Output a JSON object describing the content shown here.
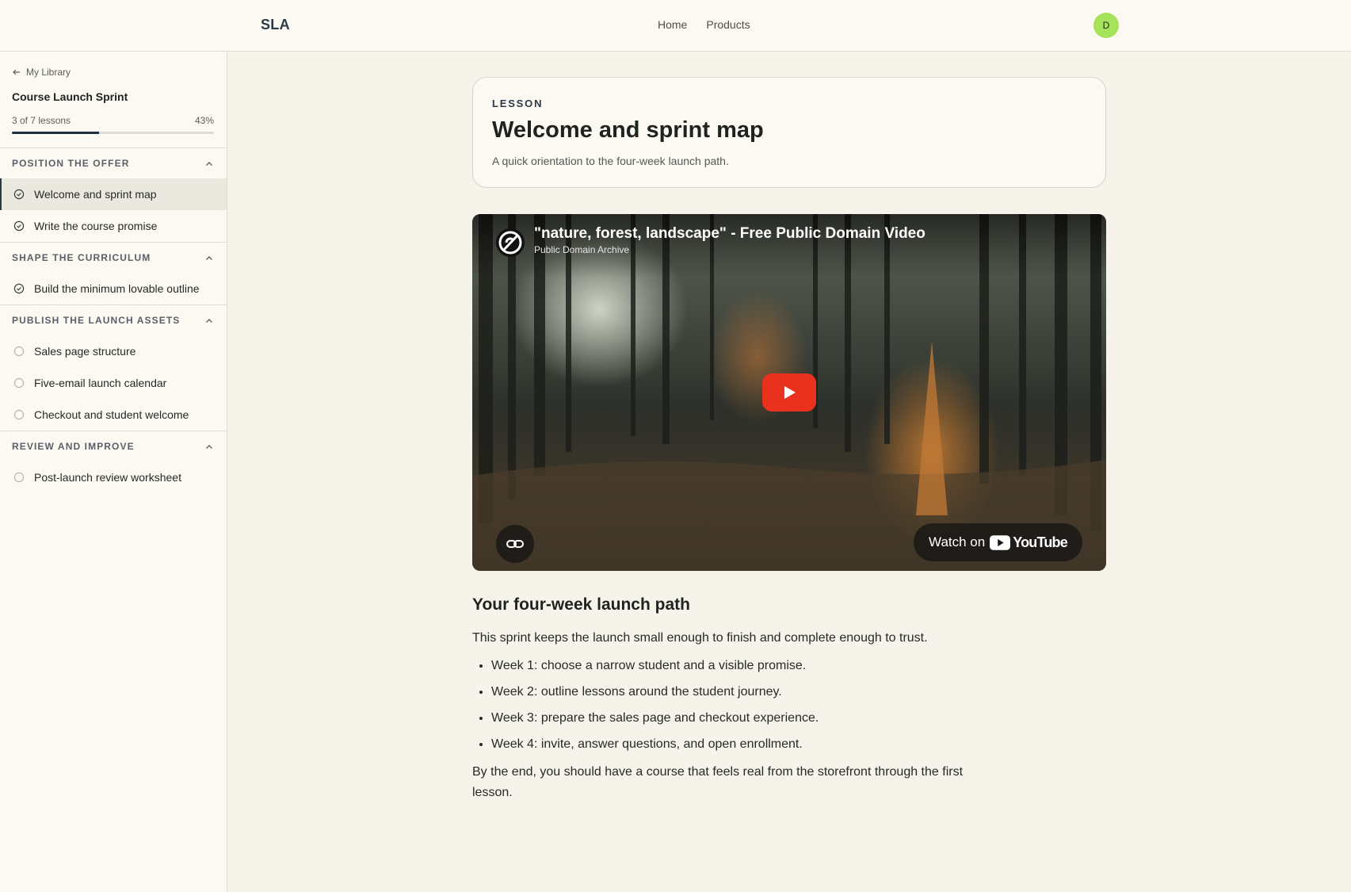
{
  "header": {
    "brand": "SLA",
    "nav": [
      "Home",
      "Products"
    ],
    "avatar_initial": "D"
  },
  "sidebar": {
    "back_label": "My Library",
    "course_title": "Course Launch Sprint",
    "progress_text": "3 of 7 lessons",
    "progress_percent_label": "43%",
    "progress_fraction": 0.43,
    "modules": [
      {
        "title": "POSITION THE OFFER",
        "lessons": [
          {
            "label": "Welcome and sprint map",
            "completed": true,
            "active": true
          },
          {
            "label": "Write the course promise",
            "completed": true,
            "active": false
          }
        ]
      },
      {
        "title": "SHAPE THE CURRICULUM",
        "lessons": [
          {
            "label": "Build the minimum lovable outline",
            "completed": true,
            "active": false
          }
        ]
      },
      {
        "title": "PUBLISH THE LAUNCH ASSETS",
        "lessons": [
          {
            "label": "Sales page structure",
            "completed": false,
            "active": false
          },
          {
            "label": "Five-email launch calendar",
            "completed": false,
            "active": false
          },
          {
            "label": "Checkout and student welcome",
            "completed": false,
            "active": false
          }
        ]
      },
      {
        "title": "REVIEW AND IMPROVE",
        "lessons": [
          {
            "label": "Post-launch review worksheet",
            "completed": false,
            "active": false
          }
        ]
      }
    ]
  },
  "lesson": {
    "kicker": "LESSON",
    "title": "Welcome and sprint map",
    "subtitle": "A quick orientation to the four-week launch path."
  },
  "video": {
    "title": "\"nature, forest, landscape\" - Free Public Domain Video",
    "channel": "Public Domain Archive",
    "watch_on": "Watch on",
    "platform": "YouTube"
  },
  "content": {
    "heading": "Your four-week launch path",
    "intro": "This sprint keeps the launch small enough to finish and complete enough to trust.",
    "list": [
      "Week 1: choose a narrow student and a visible promise.",
      "Week 2: outline lessons around the student journey.",
      "Week 3: prepare the sales page and checkout experience.",
      "Week 4: invite, answer questions, and open enrollment."
    ],
    "outro": "By the end, you should have a course that feels real from the storefront through the first lesson."
  },
  "colors": {
    "accent": "#2c3a48",
    "avatar": "#a6e35a",
    "play": "#e8321e",
    "background": "#f6f3ea"
  }
}
